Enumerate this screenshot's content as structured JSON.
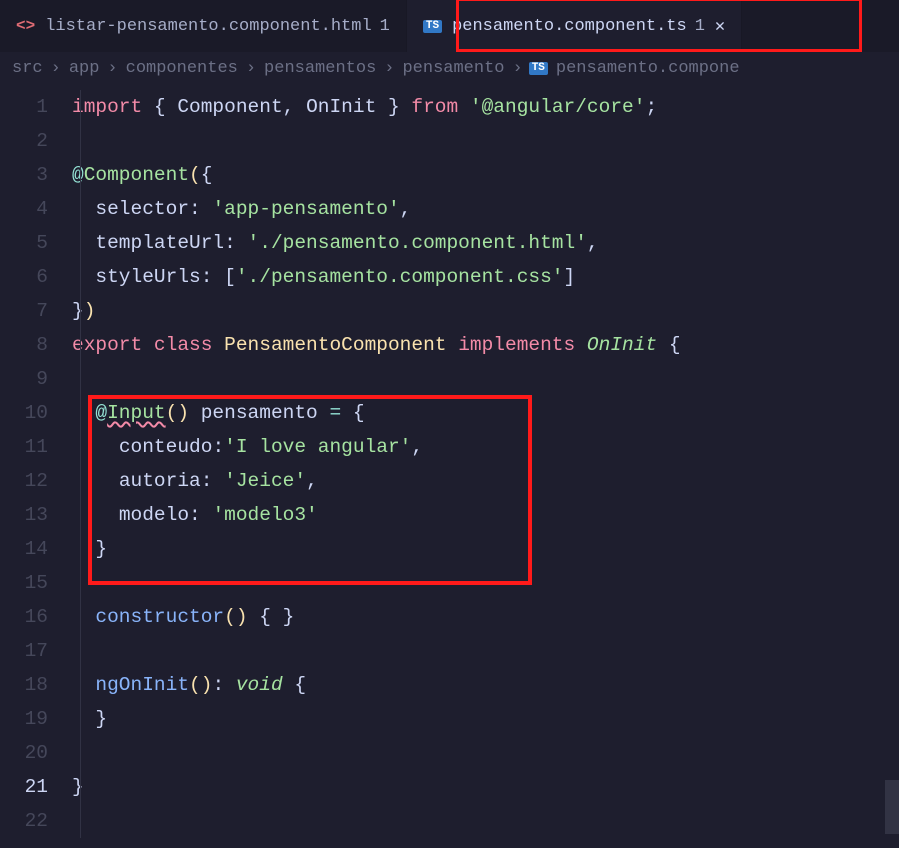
{
  "tabs": [
    {
      "label": "listar-pensamento.component.html",
      "dirty": "1",
      "icon": "html"
    },
    {
      "label": "pensamento.component.ts",
      "dirty": "1",
      "icon": "ts",
      "active": true,
      "closeable": true
    }
  ],
  "breadcrumb": {
    "parts": [
      "src",
      "app",
      "componentes",
      "pensamentos",
      "pensamento"
    ],
    "file": "pensamento.compone"
  },
  "gutter": {
    "lines": 22,
    "active": 21
  },
  "tokens": {
    "import": "import",
    "from": "from",
    "angular_core": "'@angular/core'",
    "Component": "Component",
    "OnInit": "OnInit",
    "at": "@",
    "ComponentDeco": "Component",
    "selector_key": "selector",
    "selector_val": "'app-pensamento'",
    "templateUrl_key": "templateUrl",
    "templateUrl_val": "'./pensamento.component.html'",
    "styleUrls_key": "styleUrls",
    "styleUrls_val": "'./pensamento.component.css'",
    "export": "export",
    "class": "class",
    "PensamentoComponent": "PensamentoComponent",
    "implements": "implements",
    "Input": "Input",
    "pensamento": "pensamento",
    "conteudo_key": "conteudo",
    "conteudo_val": "'I love angular'",
    "autoria_key": "autoria",
    "autoria_val": "'Jeice'",
    "modelo_key": "modelo",
    "modelo_val": "'modelo3'",
    "constructor": "constructor",
    "ngOnInit": "ngOnInit",
    "void": "void"
  }
}
